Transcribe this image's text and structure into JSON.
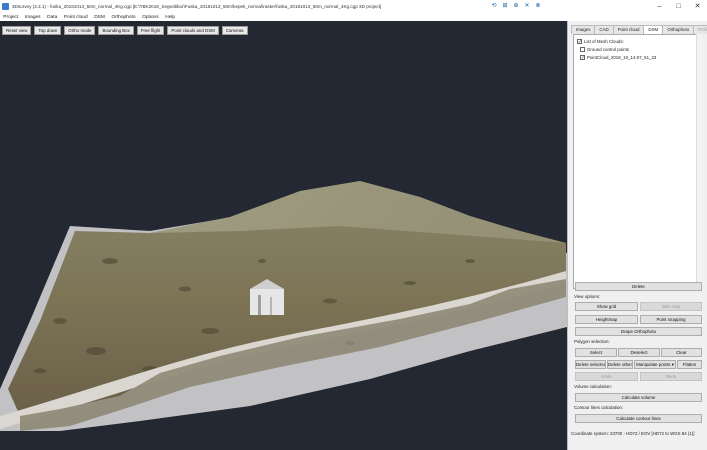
{
  "window": {
    "title": "3Dsurvey (2.3.1) - fuska_20181013_50m_normal_4Kg.cgp [E:\\TBK2018_Segedtibor\\Fuska_20181013_50m\\kepek_normal\\raster\\fuska_20181013_50m_normal_4Kg.cgp 3D project]",
    "toolbar_icons": [
      "⟲",
      "⊞",
      "⊕",
      "✕",
      "⊗"
    ],
    "controls": {
      "minimize": "–",
      "maximize": "□",
      "close": "✕"
    }
  },
  "menu": [
    "Project",
    "Images",
    "Data",
    "Point cloud",
    "DSM",
    "Orthophoto",
    "Options",
    "Help"
  ],
  "viewport_toolbar": [
    "Reset view",
    "Top down",
    "Ortho mode",
    "Bounding Box",
    "Free flight",
    "Point clouds and DSM",
    "Cameras"
  ],
  "panel": {
    "tabs": [
      "Images",
      "CAD",
      "Point cloud",
      "DSM",
      "Orthophoto",
      "Profile"
    ],
    "active_tab": "DSM",
    "list_header": "List of Mesh Clouds:",
    "items": [
      "Ground control points",
      "PointCloud_2018_10_14-07_51_23"
    ],
    "delete": "Delete",
    "view_options": "View options:",
    "show_grid": "Show grid",
    "wire_only": "Wire only",
    "heightmap": "Heightmap",
    "point_snapping": "Point snapping",
    "drape_ortho": "Drape Orthophoto",
    "polygon_selection": "Polygon selection:",
    "select": "Select",
    "deselect": "Deselect",
    "clear": "Clear",
    "delete_selected": "Delete selected",
    "delete_other": "Delete other",
    "manipulate_points": "Manipulate points ▾",
    "flatten": "Flatten",
    "undo": "Undo",
    "redo": "Redo",
    "volume_calc": "Volume calculation:",
    "calc_volume": "Calculate volume",
    "contour_calc": "Contour lines calculation:",
    "calc_contour": "Calculate contour lines"
  },
  "status": "Coordinate system: 23700 - HD72 / EOV [HD72 to WGS 84 (1)]",
  "colors": {
    "viewport_bg": "#232832",
    "panel_bg": "#f0f0f0",
    "accent": "#1f5fa8"
  }
}
